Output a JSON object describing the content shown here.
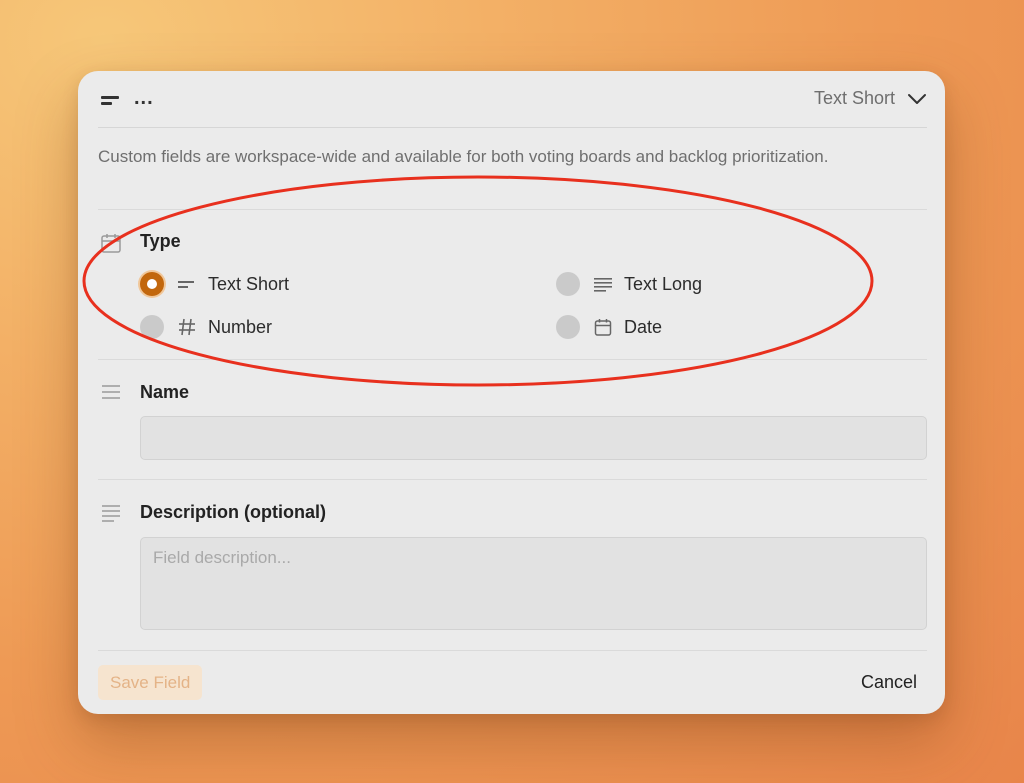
{
  "colors": {
    "accent": "#c2670d",
    "annotation_circle": "#e8301e"
  },
  "header": {
    "icon": "text-short-icon",
    "title": "...",
    "type_dropdown_label": "Text Short",
    "dropdown_icon": "chevron-down-icon"
  },
  "info_text": "Custom fields are workspace-wide and available for both voting boards and backlog prioritization.",
  "type_section": {
    "icon": "calendar-icon",
    "label": "Type",
    "selected": "Text Short",
    "options": [
      {
        "label": "Text Short",
        "icon": "text-short-icon",
        "selected": true
      },
      {
        "label": "Text Long",
        "icon": "text-long-icon",
        "selected": false
      },
      {
        "label": "Number",
        "icon": "hash-icon",
        "selected": false
      },
      {
        "label": "Date",
        "icon": "calendar-icon",
        "selected": false
      }
    ]
  },
  "name_section": {
    "icon": "menu-lines-icon",
    "label": "Name",
    "value": "",
    "placeholder": ""
  },
  "description_section": {
    "icon": "text-lines-icon",
    "label": "Description (optional)",
    "value": "",
    "placeholder": "Field description..."
  },
  "footer": {
    "save_label": "Save Field",
    "cancel_label": "Cancel"
  }
}
